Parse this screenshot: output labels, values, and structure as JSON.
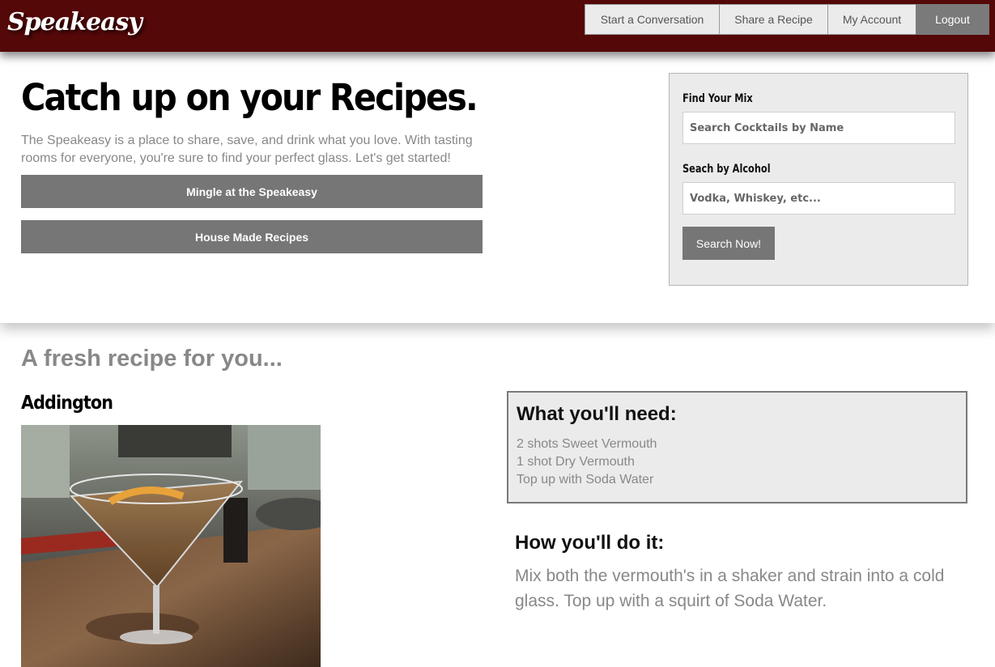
{
  "header": {
    "logo": "Speakeasy",
    "nav": [
      {
        "label": "Start a Conversation"
      },
      {
        "label": "Share a Recipe"
      },
      {
        "label": "My Account"
      },
      {
        "label": "Logout"
      }
    ]
  },
  "hero": {
    "title": "Catch up on your Recipes.",
    "description": "The Speakeasy is a place to share, save, and drink what you love. With tasting rooms for everyone, you're sure to find your perfect glass. Let's get started!",
    "buttons": [
      {
        "label": "Mingle at the Speakeasy"
      },
      {
        "label": "House Made Recipes"
      }
    ]
  },
  "search": {
    "mix_label": "Find Your Mix",
    "mix_placeholder": "Search Cocktails by Name",
    "alcohol_label": "Seach by Alcohol",
    "alcohol_placeholder": "Vodka, Whiskey, etc...",
    "button_label": "Search Now!"
  },
  "recipe": {
    "section_title": "A fresh recipe for you...",
    "name": "Addington",
    "needs_title": "What you'll need:",
    "ingredients": [
      "2 shots Sweet Vermouth",
      "1 shot Dry Vermouth",
      "Top up with Soda Water"
    ],
    "how_title": "How you'll do it:",
    "instructions": "Mix both the vermouth's in a shaker and strain into a cold glass. Top up with a squirt of Soda Water."
  },
  "colors": {
    "header_bg": "#540808",
    "button_gray": "#767676",
    "panel_bg": "#ebebeb",
    "muted_text": "#888888"
  }
}
